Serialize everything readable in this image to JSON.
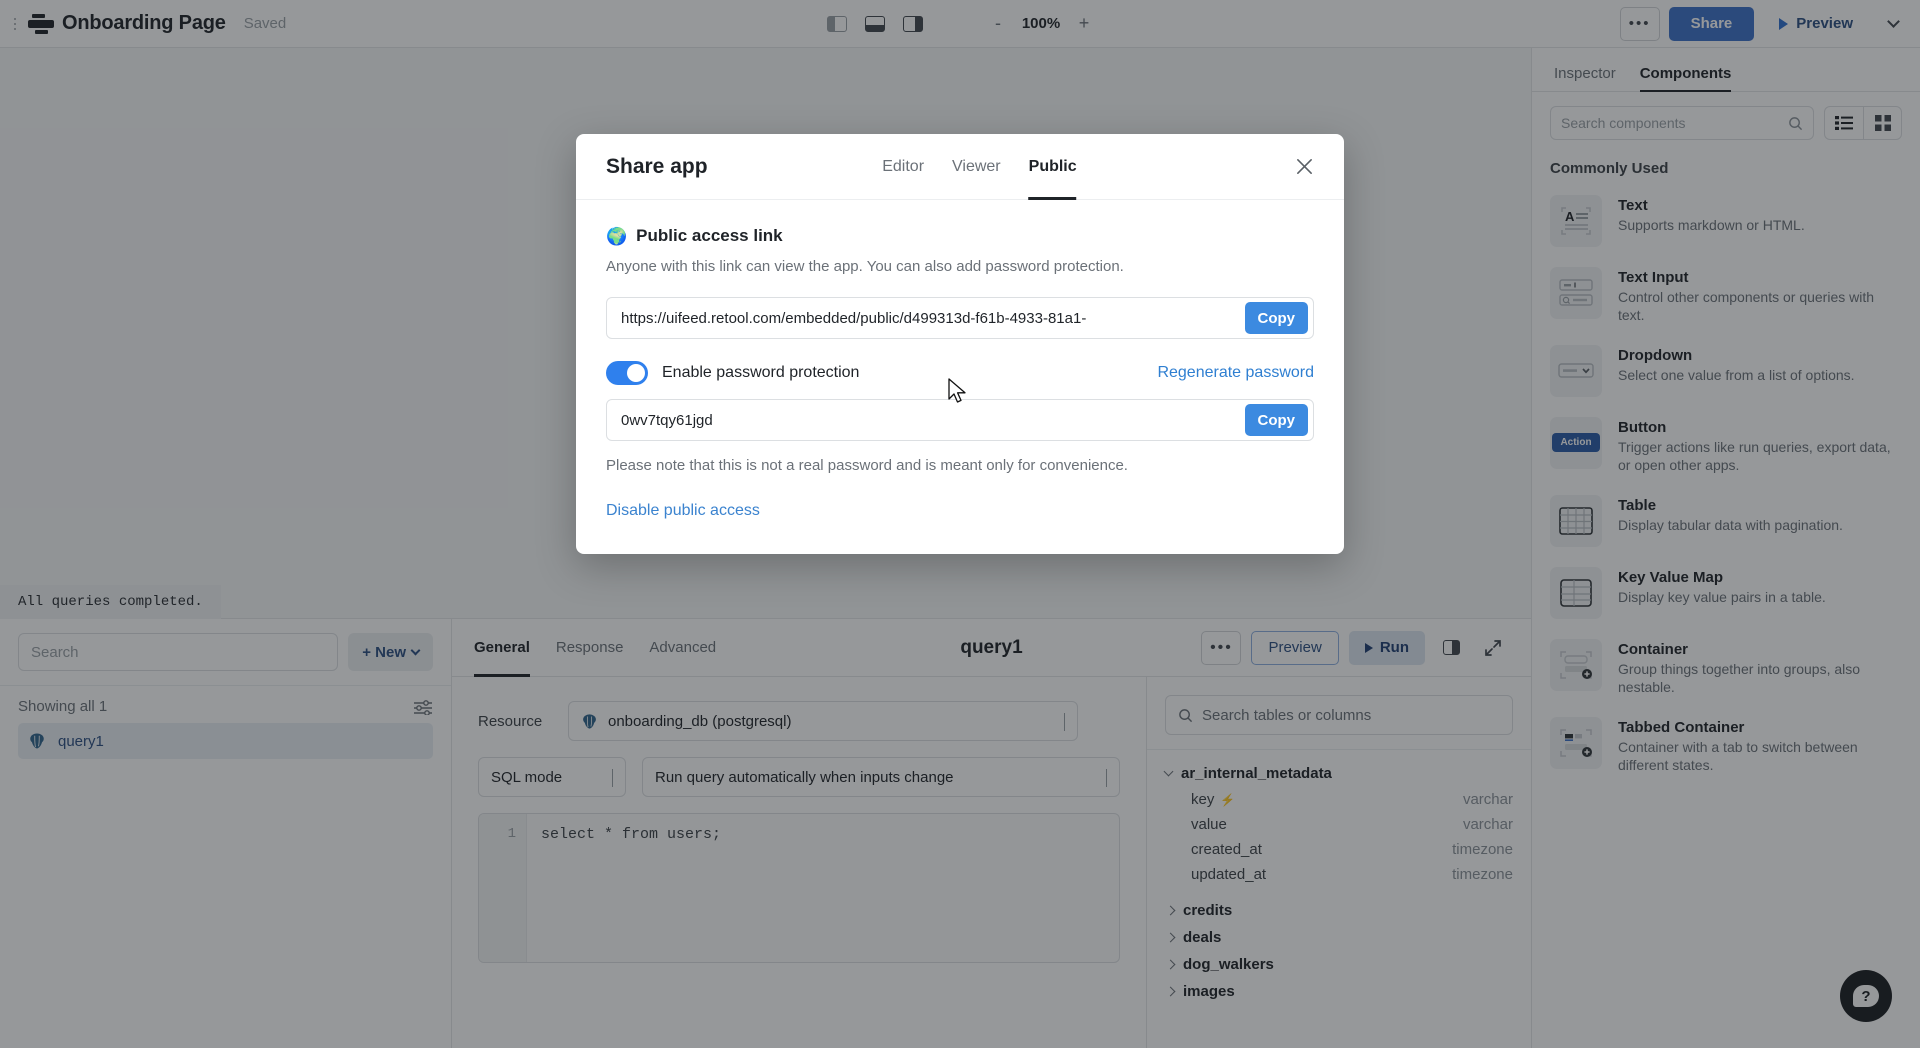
{
  "topbar": {
    "app_title": "Onboarding Page",
    "save_status": "Saved",
    "zoom_minus": "-",
    "zoom_value": "100%",
    "zoom_plus": "+",
    "ellipsis": "•••",
    "share_label": "Share",
    "preview_label": "Preview",
    "panel_left_icon": "panel-left-icon",
    "panel_bottom_icon": "panel-bottom-icon",
    "panel_right_icon": "panel-right-icon"
  },
  "right_panel": {
    "tabs": [
      {
        "label": "Inspector",
        "active": false
      },
      {
        "label": "Components",
        "active": true
      }
    ],
    "search_placeholder": "Search components",
    "section_title": "Commonly Used",
    "components": [
      {
        "name": "Text",
        "desc": "Supports markdown or HTML.",
        "icon": "text-component-icon"
      },
      {
        "name": "Text Input",
        "desc": "Control other components or queries with text.",
        "icon": "text-input-component-icon"
      },
      {
        "name": "Dropdown",
        "desc": "Select one value from a list of options.",
        "icon": "dropdown-component-icon"
      },
      {
        "name": "Button",
        "desc": "Trigger actions like run queries, export data, or open other apps.",
        "icon": "button-component-icon",
        "thumb_label": "Action"
      },
      {
        "name": "Table",
        "desc": "Display tabular data with pagination.",
        "icon": "table-component-icon"
      },
      {
        "name": "Key Value Map",
        "desc": "Display key value pairs in a table.",
        "icon": "key-value-map-component-icon"
      },
      {
        "name": "Container",
        "desc": "Group things together into groups, also nestable.",
        "icon": "container-component-icon"
      },
      {
        "name": "Tabbed Container",
        "desc": "Container with a tab to switch between different states.",
        "icon": "tabbed-container-component-icon"
      }
    ]
  },
  "query_pane": {
    "status_text": "All queries completed.",
    "search_placeholder": "Search",
    "new_button": "+ New",
    "showing_text": "Showing all 1",
    "query_list": [
      {
        "name": "query1",
        "icon": "postgres-icon"
      }
    ],
    "tabs": [
      {
        "label": "General",
        "active": true
      },
      {
        "label": "Response",
        "active": false
      },
      {
        "label": "Advanced",
        "active": false
      }
    ],
    "query_name": "query1",
    "ellipsis": "•••",
    "preview_label": "Preview",
    "run_label": "Run",
    "resource_label": "Resource",
    "resource_value": "onboarding_db (postgresql)",
    "sql_mode_value": "SQL mode",
    "trigger_value": "Run query automatically when inputs change",
    "code_line_number": "1",
    "code_text": "select * from users;",
    "schema_search_placeholder": "Search tables or columns",
    "schema": [
      {
        "table": "ar_internal_metadata",
        "expanded": true,
        "columns": [
          {
            "name": "key",
            "type": "varchar",
            "key": true
          },
          {
            "name": "value",
            "type": "varchar",
            "key": false
          },
          {
            "name": "created_at",
            "type": "timezone",
            "key": false
          },
          {
            "name": "updated_at",
            "type": "timezone",
            "key": false
          }
        ]
      },
      {
        "table": "credits",
        "expanded": false,
        "columns": []
      },
      {
        "table": "deals",
        "expanded": false,
        "columns": []
      },
      {
        "table": "dog_walkers",
        "expanded": false,
        "columns": []
      },
      {
        "table": "images",
        "expanded": false,
        "columns": []
      }
    ]
  },
  "modal": {
    "title": "Share app",
    "tabs": [
      {
        "label": "Editor",
        "active": false
      },
      {
        "label": "Viewer",
        "active": false
      },
      {
        "label": "Public",
        "active": true
      }
    ],
    "close_icon": "close-icon",
    "section_icon": "globe-icon",
    "section_title": "Public access link",
    "section_subtitle": "Anyone with this link can view the app. You can also add password protection.",
    "link_value": "https://uifeed.retool.com/embedded/public/d499313d-f61b-4933-81a1-",
    "link_copy_label": "Copy",
    "toggle_on": true,
    "toggle_label": "Enable password protection",
    "regenerate_label": "Regenerate password",
    "password_value": "0wv7tqy61jgd",
    "password_copy_label": "Copy",
    "note": "Please note that this is not a real password and is meant only for convenience.",
    "disable_link": "Disable public access"
  },
  "help_button": {
    "label": "?"
  },
  "colors": {
    "accent_blue": "#3c8ae0",
    "share_blue": "#3c71c9",
    "toggle_blue": "#2f80ed",
    "link_blue": "#3b83cf",
    "text_dark": "#1f2328",
    "text_muted": "#6b7178"
  }
}
